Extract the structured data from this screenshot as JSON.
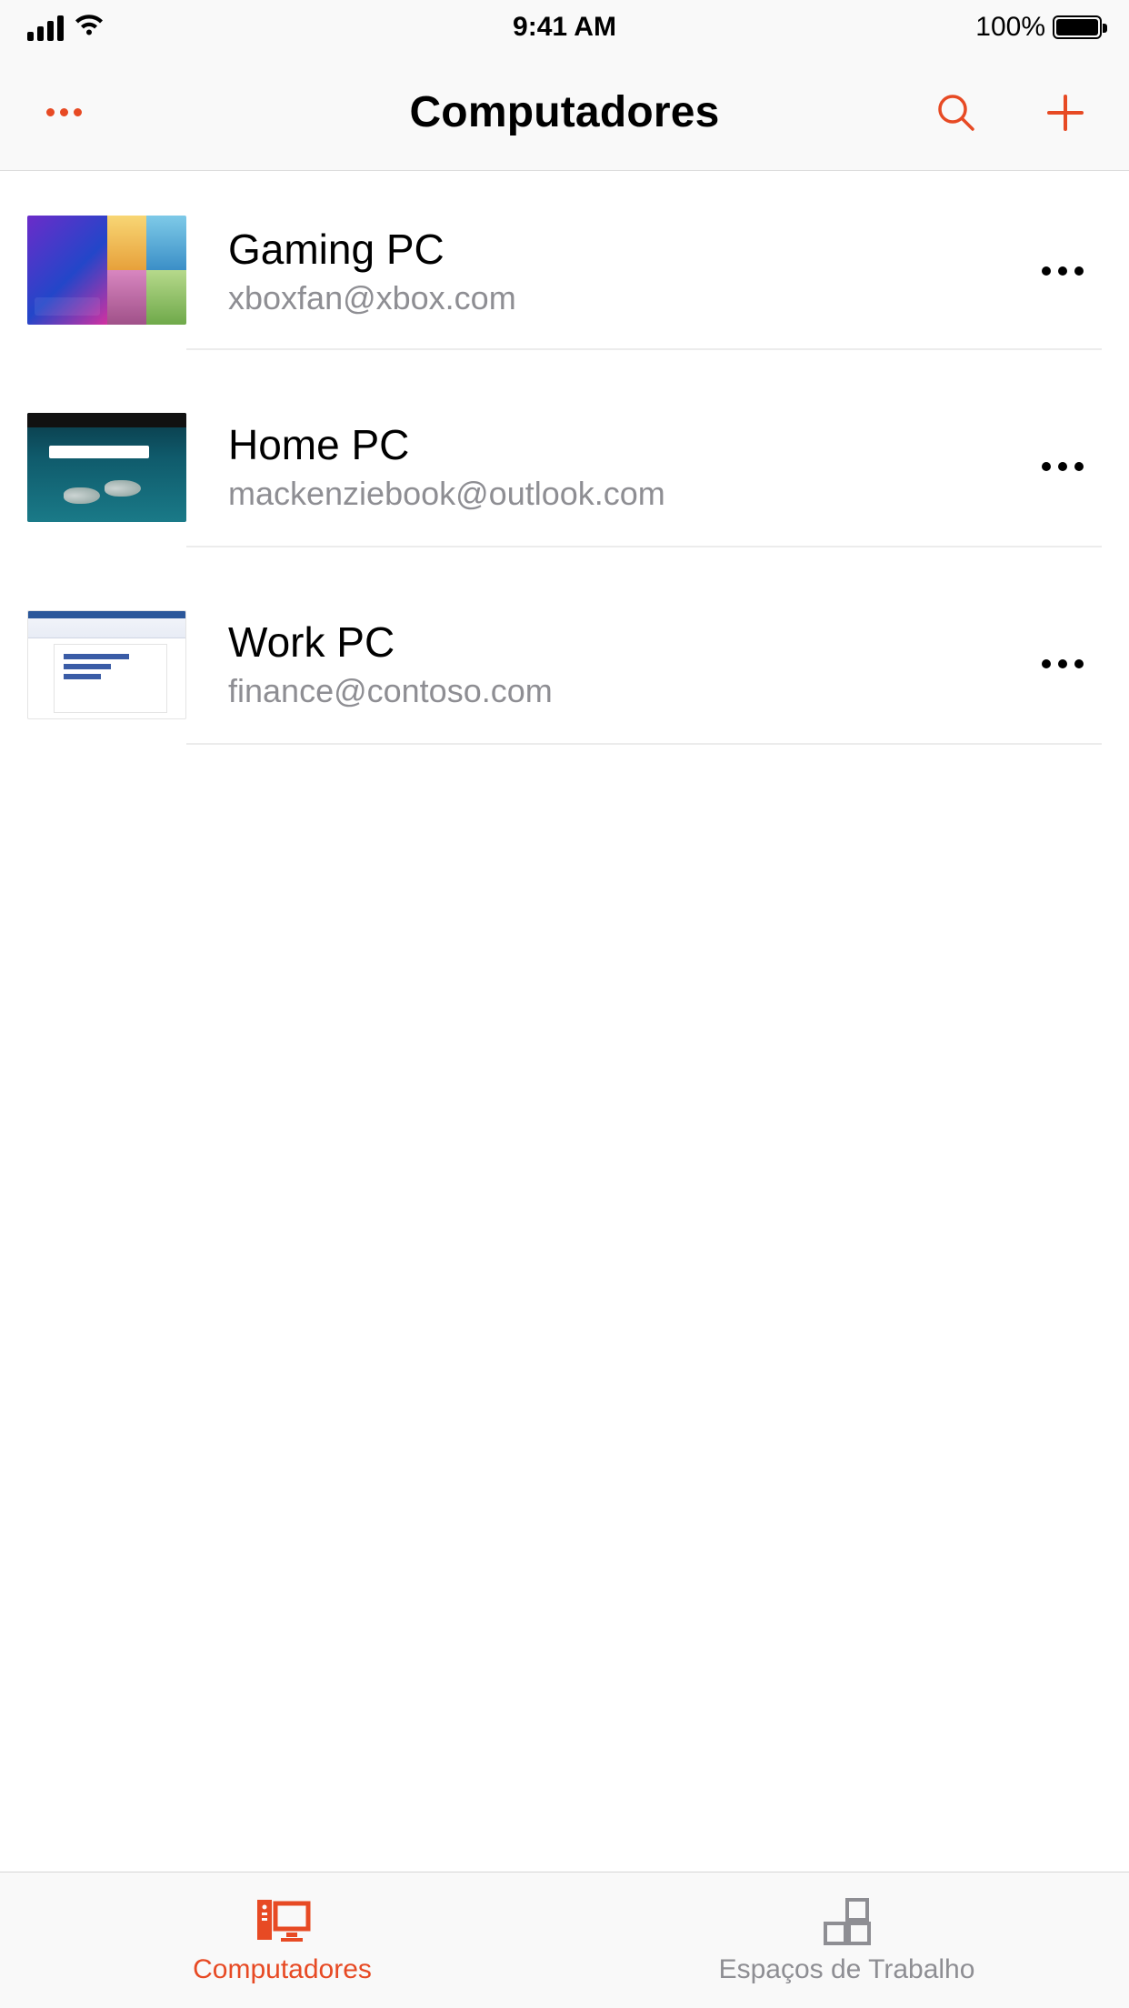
{
  "status": {
    "time": "9:41 AM",
    "battery_pct": "100%"
  },
  "nav": {
    "title": "Computadores"
  },
  "computers": [
    {
      "name": "Gaming PC",
      "account": "xboxfan@xbox.com"
    },
    {
      "name": "Home PC",
      "account": "mackenziebook@outlook.com"
    },
    {
      "name": "Work PC",
      "account": "finance@contoso.com"
    }
  ],
  "tabs": {
    "computers": "Computadores",
    "workspaces": "Espaços de Trabalho"
  },
  "colors": {
    "accent": "#e74a24"
  }
}
